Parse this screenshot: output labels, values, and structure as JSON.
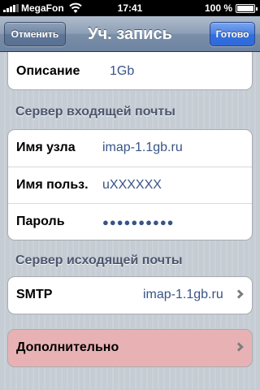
{
  "status_bar": {
    "carrier": "MegaFon",
    "time": "17:41",
    "battery": "100 %"
  },
  "nav": {
    "title": "Уч. запись",
    "cancel_label": "Отменить",
    "done_label": "Готово"
  },
  "description_row": {
    "label": "Описание",
    "value": "1Gb"
  },
  "incoming": {
    "header": "Сервер входящей почты",
    "host_label": "Имя узла",
    "host_value": "imap-1.1gb.ru",
    "user_label": "Имя польз.",
    "user_value": "uXXXXXX",
    "password_label": "Пароль",
    "password_value": "●●●●●●●●●●"
  },
  "outgoing": {
    "header": "Сервер исходящей почты",
    "smtp_label": "SMTP",
    "smtp_value": "imap-1.1gb.ru"
  },
  "advanced": {
    "label": "Дополнительно",
    "highlight_color": "#e8b2b4"
  },
  "icons": {
    "signal": "signal-bars-icon",
    "wifi": "wifi-icon",
    "battery": "battery-icon",
    "chevron": "chevron-right-icon"
  }
}
